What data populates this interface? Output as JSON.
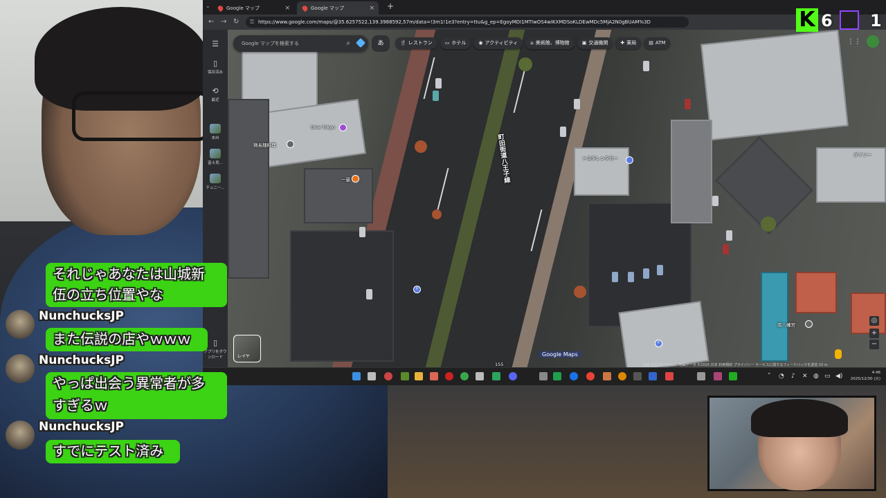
{
  "browser": {
    "tabs": [
      {
        "label": "Google マップ"
      },
      {
        "label": "Google マップ"
      }
    ],
    "url": "https://www.google.com/maps/@35.6257522,139.3988592,57m/data=!3m1!1e3?entry=ttu&g_ep=EgoyMDI1MTIwOS4wIKXMDSoKLDEwMDc5MjA2N0gBUAM%3D"
  },
  "maps": {
    "search_placeholder": "Google マップを検索する",
    "input_mode": "あ",
    "chips": [
      {
        "icon": "restaurant-icon",
        "label": "レストラン"
      },
      {
        "icon": "hotel-icon",
        "label": "ホテル"
      },
      {
        "icon": "activity-icon",
        "label": "アクティビティ"
      },
      {
        "icon": "museum-icon",
        "label": "美術館、博物館"
      },
      {
        "icon": "transit-icon",
        "label": "交通機関"
      },
      {
        "icon": "pharmacy-icon",
        "label": "薬局"
      },
      {
        "icon": "atm-icon",
        "label": "ATM"
      }
    ],
    "sidebar": [
      {
        "icon": "menu-icon",
        "label": ""
      },
      {
        "icon": "bookmark-icon",
        "label": "保存済み"
      },
      {
        "icon": "history-icon",
        "label": "最近"
      },
      {
        "icon": "thumb",
        "label": "本州"
      },
      {
        "icon": "thumb",
        "label": "富士見..."
      },
      {
        "icon": "thumb",
        "label": "チュニー..."
      }
    ],
    "app_download": "アプリをダウンロード",
    "layer_label": "レイヤ",
    "road_label": "町田街道八王子線",
    "place_labels": [
      "time Tokyo",
      "鶏長麺料理",
      "一蘭",
      "トヨタレンタカー",
      "南八幡宮",
      "ダイソー"
    ],
    "parking_label": "P",
    "road_number": "155",
    "logo": "Google Maps",
    "attribution": "画像 ©2025 Airbus、地図データ ©2025   日本   利用規約   プライバシー   サービスに関するフィードバックを送信   10 m"
  },
  "taskbar": {
    "time": "4:46",
    "date": "2025/12/30 (火)"
  },
  "overlay": {
    "kick_logo": "K",
    "kick_viewers": "6",
    "twitch_viewers": "1"
  },
  "chat": [
    {
      "type": "bubble",
      "text": "それじゃあなたは山城新"
    },
    {
      "type": "bubble",
      "text": "伍の立ち位置やな"
    },
    {
      "type": "user",
      "name": "NunchucksJP"
    },
    {
      "type": "bubble",
      "text": "また伝説の店やｗｗｗ"
    },
    {
      "type": "user",
      "name": "NunchucksJP"
    },
    {
      "type": "bubble",
      "text": "やっぱ出会う異常者が多"
    },
    {
      "type": "bubble",
      "text": "すぎるｗ"
    },
    {
      "type": "user",
      "name": "NunchucksJP"
    },
    {
      "type": "bubble",
      "text": "すでにテスト済み"
    }
  ]
}
